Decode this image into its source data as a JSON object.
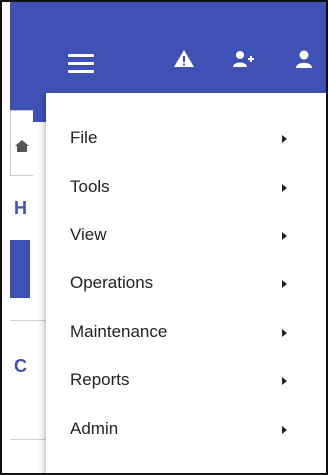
{
  "background": {
    "partial_heading_1": "H",
    "partial_heading_2": "C"
  },
  "menu": {
    "items": [
      {
        "label": "File"
      },
      {
        "label": "Tools"
      },
      {
        "label": "View"
      },
      {
        "label": "Operations"
      },
      {
        "label": "Maintenance"
      },
      {
        "label": "Reports"
      },
      {
        "label": "Admin"
      }
    ]
  },
  "colors": {
    "toolbar": "#3f51b5",
    "menu_text": "#222222"
  },
  "icons": {
    "menu": "hamburger-icon",
    "alert": "warning-icon",
    "add_user": "add-user-icon",
    "user": "user-icon"
  }
}
